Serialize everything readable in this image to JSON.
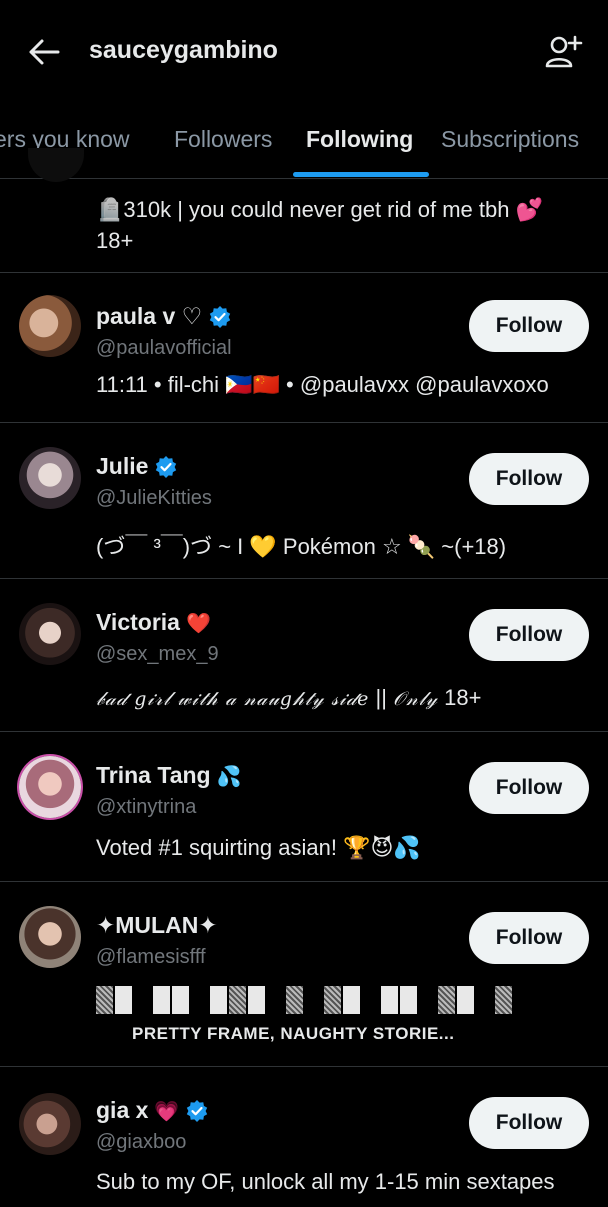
{
  "header": {
    "title": "sauceygambino",
    "back_icon": "arrow-left-icon",
    "add_icon": "add-person-icon"
  },
  "tabs": [
    {
      "label": "ers you know",
      "active": false
    },
    {
      "label": "Followers",
      "active": false
    },
    {
      "label": "Following",
      "active": true
    },
    {
      "label": "Subscriptions",
      "active": false
    }
  ],
  "colors": {
    "accent": "#1d9bf0",
    "background": "#000000",
    "muted": "#71767b",
    "button_bg": "#eff3f4"
  },
  "partial_item": {
    "bio_line1": "🪦310k | you could never get rid of me tbh 💕",
    "bio_line2": "18+"
  },
  "users": [
    {
      "name": "paula v ♡",
      "verified": true,
      "handle": "@paulavofficial",
      "bio": "11:11 • fil-chi 🇵🇭🇨🇳 • @paulavxx @paulavxoxo",
      "button": "Follow"
    },
    {
      "name": "Julie",
      "verified": true,
      "handle": "@JulieKitties",
      "bio": "(づ￣ ³￣)づ ~ I 💛 Pokémon ☆ 🍡 ~(+18)",
      "button": "Follow"
    },
    {
      "name": "Victoria",
      "name_suffix": "❤️",
      "verified": false,
      "handle": "@sex_mex_9",
      "bio_script": "𝒷𝒶𝒹 𝑔𝒾𝓇𝓁 𝓌𝒾𝓉𝒽 𝒶 𝓃𝒶𝓊𝑔𝒽𝓉𝓎 𝓈𝒾𝒹𝑒",
      "bio_mid": " || ",
      "bio_script2": "𝒪𝓃𝓁𝓎",
      "bio_end": " 18+",
      "button": "Follow"
    },
    {
      "name": "Trina Tang",
      "name_suffix": "💦",
      "verified": false,
      "handle": "@xtinytrina",
      "bio": "Voted #1 squirting asian! 🏆😈💦",
      "button": "Follow"
    },
    {
      "name": "✦MULAN✦",
      "verified": false,
      "handle": "@flamesisfff",
      "caption": "PRETTY FRAME, NAUGHTY STORIE...",
      "button": "Follow"
    },
    {
      "name": "gia x",
      "name_suffix": "💗",
      "verified": true,
      "handle": "@giaxboo",
      "bio": "Sub to my OF, unlock all my 1-15 min sextapes",
      "button": "Follow"
    }
  ]
}
